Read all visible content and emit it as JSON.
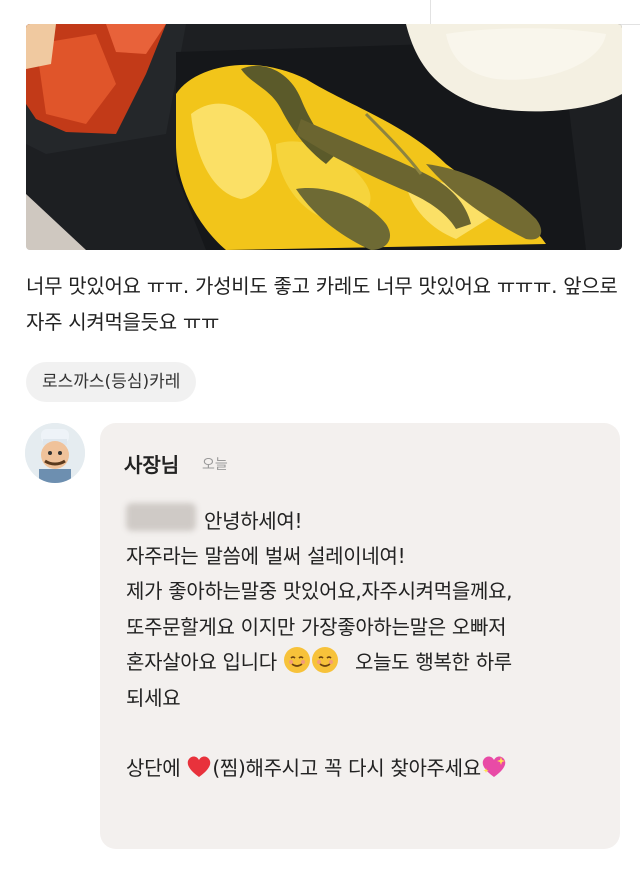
{
  "review": {
    "text": "너무 맛있어요 ㅠㅠ. 가성비도 좋고 카레도 너무 맛있어요 ㅠㅠㅠ. 앞으로 자주 시켜먹을듯요 ㅠㅠ",
    "menu_tag": "로스까스(등심)카레"
  },
  "reply": {
    "owner": "사장님",
    "date": "오늘",
    "greeting": "안녕하세여!",
    "line2": "자주라는 말씀에 벌써 설레이네여!",
    "line3": "제가 좋아하는말중 맛있어요,자주시켜먹을께요,",
    "line4": "또주문할게요 이지만 가장좋아하는말은 오빠저",
    "line5_start": "혼자살아요 입니다",
    "line5_end": "오늘도 행복한 하루",
    "line6": "되세요",
    "line7_start": "상단에",
    "line7_mid": "(찜)해주시고 꼭 다시 찾아주세요"
  },
  "icons": {
    "smile": "smiling-face-icon",
    "heart": "red-heart-icon",
    "sparkle_heart": "sparkling-heart-icon"
  },
  "colors": {
    "reply_bg": "#f3f0ee",
    "tag_bg": "#f1f1f1",
    "heart": "#e8323c",
    "sparkle_heart": "#e84ba6"
  }
}
